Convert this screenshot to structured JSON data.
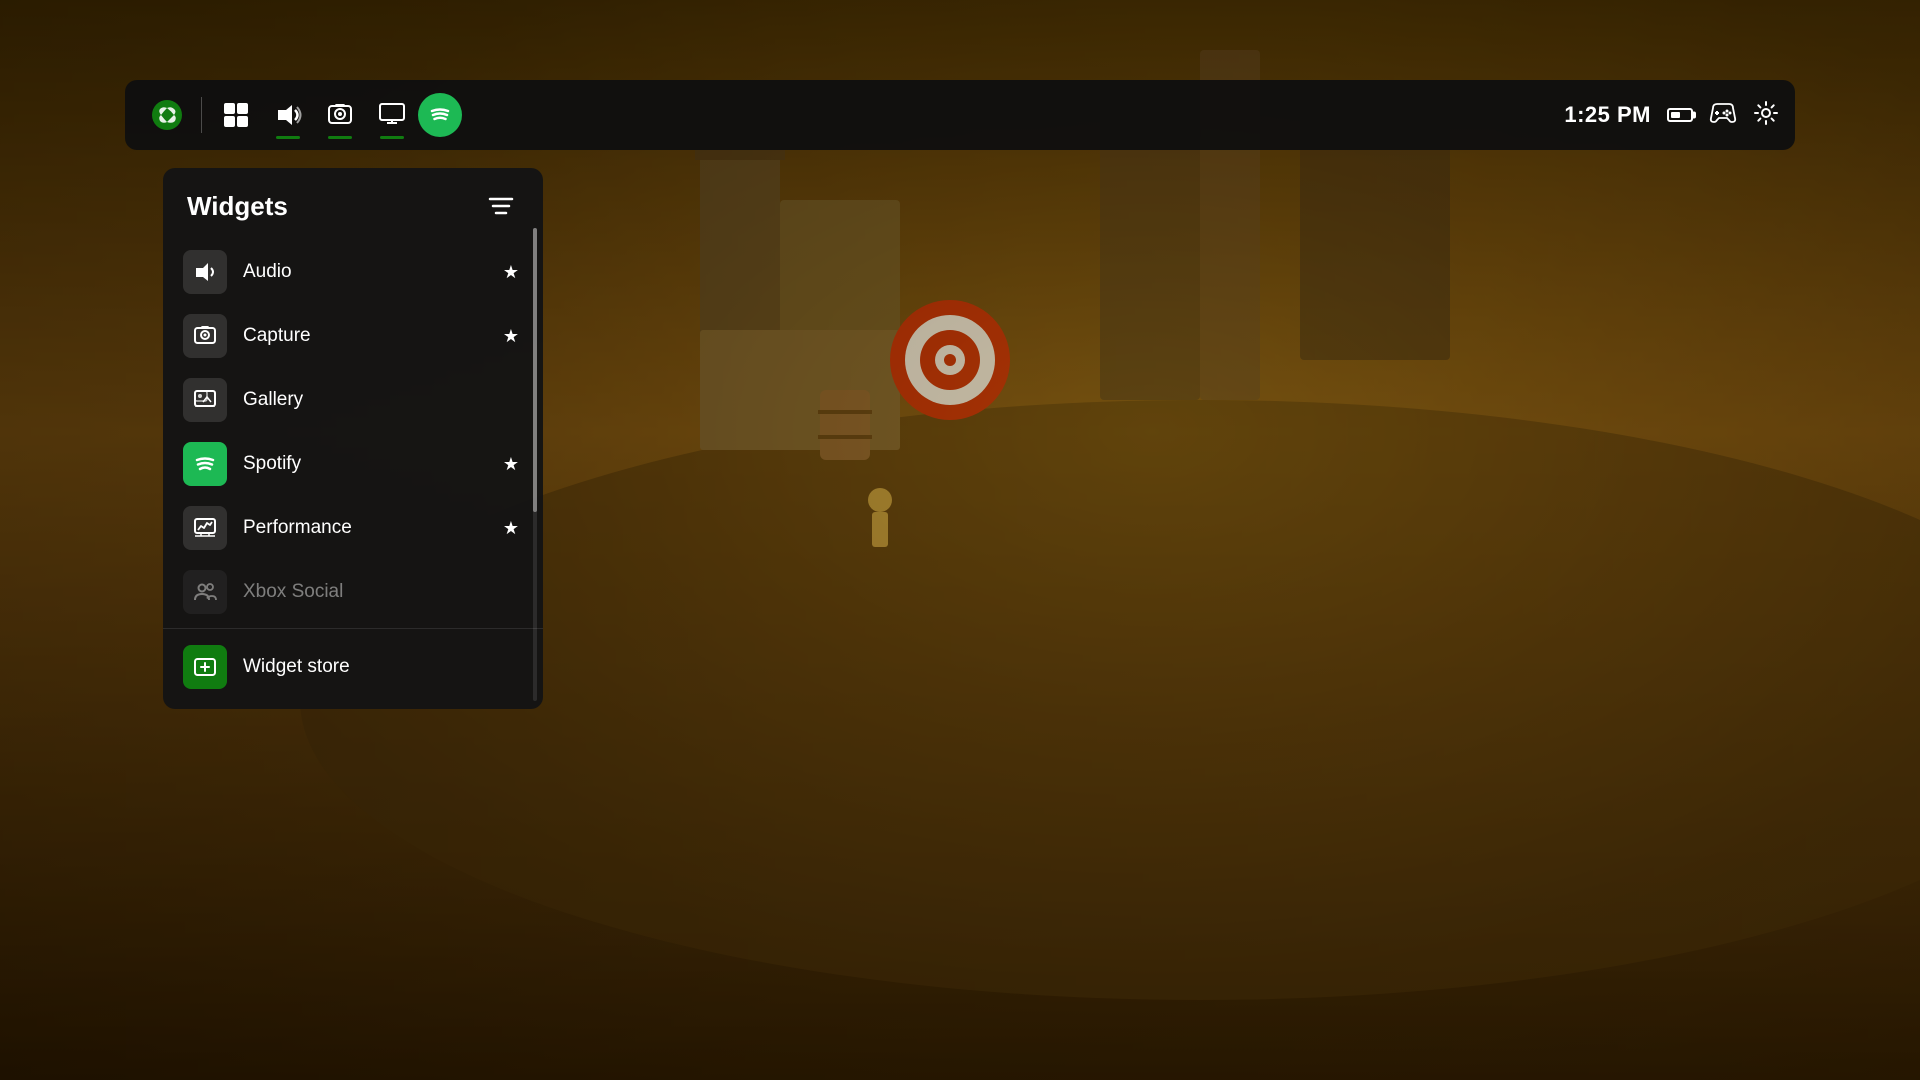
{
  "background": {
    "color": "#1a0f00"
  },
  "topbar": {
    "time": "1:25 PM",
    "icons": {
      "xbox": "xbox-logo",
      "multiview": "multiview-icon",
      "audio": "audio-icon",
      "capture": "capture-icon",
      "display": "display-icon",
      "spotify": "spotify-icon",
      "battery": "battery-icon",
      "controller": "controller-icon",
      "settings": "settings-icon"
    }
  },
  "widgets_panel": {
    "title": "Widgets",
    "items": [
      {
        "id": "audio",
        "name": "Audio",
        "starred": true,
        "disabled": false
      },
      {
        "id": "capture",
        "name": "Capture",
        "starred": true,
        "disabled": false
      },
      {
        "id": "gallery",
        "name": "Gallery",
        "starred": false,
        "disabled": false
      },
      {
        "id": "spotify",
        "name": "Spotify",
        "starred": true,
        "disabled": false
      },
      {
        "id": "performance",
        "name": "Performance",
        "starred": true,
        "disabled": false
      },
      {
        "id": "xbox-social",
        "name": "Xbox Social",
        "starred": false,
        "disabled": true
      }
    ],
    "store_item": {
      "name": "Widget store"
    },
    "filter_label": "filter"
  }
}
